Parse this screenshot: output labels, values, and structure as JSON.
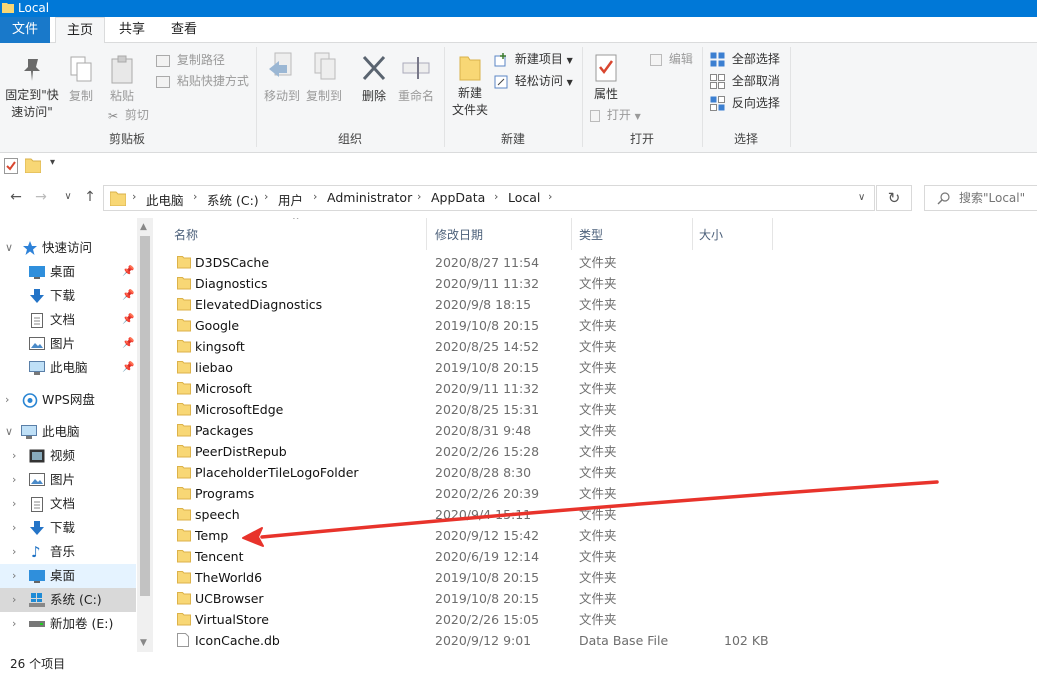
{
  "window": {
    "title": "Local"
  },
  "tabs": {
    "file": "文件",
    "home": "主页",
    "share": "共享",
    "view": "查看"
  },
  "ribbon": {
    "clipboard": {
      "title": "剪贴板",
      "pin": "固定到\"快\n速访问\"",
      "copy": "复制",
      "paste": "粘贴",
      "copy_path": "复制路径",
      "paste_shortcut": "粘贴快捷方式",
      "cut": "剪切"
    },
    "organize": {
      "title": "组织",
      "move_to": "移动到",
      "copy_to": "复制到",
      "delete": "删除",
      "rename": "重命名"
    },
    "new": {
      "title": "新建",
      "new_folder": "新建\n文件夹",
      "new_item": "新建项目",
      "easy_access": "轻松访问"
    },
    "open": {
      "title": "打开",
      "properties": "属性",
      "open": "打开",
      "edit": "编辑"
    },
    "select": {
      "title": "选择",
      "select_all": "全部选择",
      "select_none": "全部取消",
      "invert": "反向选择"
    }
  },
  "address": {
    "crumbs": [
      "此电脑",
      "系统 (C:)",
      "用户",
      "Administrator",
      "AppData",
      "Local"
    ],
    "search_placeholder": "搜索\"Local\""
  },
  "nav": {
    "quick_access": "快速访问",
    "quick_items": [
      "桌面",
      "下载",
      "文档",
      "图片",
      "此电脑"
    ],
    "wps": "WPS网盘",
    "this_pc": "此电脑",
    "pc_items": [
      "视频",
      "图片",
      "文档",
      "下载",
      "音乐",
      "桌面",
      "系统 (C:)",
      "新加卷 (E:)"
    ]
  },
  "columns": {
    "name": "名称",
    "date": "修改日期",
    "type": "类型",
    "size": "大小"
  },
  "files": [
    {
      "name": "D3DSCache",
      "date": "2020/8/27 11:54",
      "type": "文件夹",
      "size": ""
    },
    {
      "name": "Diagnostics",
      "date": "2020/9/11 11:32",
      "type": "文件夹",
      "size": ""
    },
    {
      "name": "ElevatedDiagnostics",
      "date": "2020/9/8 18:15",
      "type": "文件夹",
      "size": ""
    },
    {
      "name": "Google",
      "date": "2019/10/8 20:15",
      "type": "文件夹",
      "size": ""
    },
    {
      "name": "kingsoft",
      "date": "2020/8/25 14:52",
      "type": "文件夹",
      "size": ""
    },
    {
      "name": "liebao",
      "date": "2019/10/8 20:15",
      "type": "文件夹",
      "size": ""
    },
    {
      "name": "Microsoft",
      "date": "2020/9/11 11:32",
      "type": "文件夹",
      "size": ""
    },
    {
      "name": "MicrosoftEdge",
      "date": "2020/8/25 15:31",
      "type": "文件夹",
      "size": ""
    },
    {
      "name": "Packages",
      "date": "2020/8/31 9:48",
      "type": "文件夹",
      "size": ""
    },
    {
      "name": "PeerDistRepub",
      "date": "2020/2/26 15:28",
      "type": "文件夹",
      "size": ""
    },
    {
      "name": "PlaceholderTileLogoFolder",
      "date": "2020/8/28 8:30",
      "type": "文件夹",
      "size": ""
    },
    {
      "name": "Programs",
      "date": "2020/2/26 20:39",
      "type": "文件夹",
      "size": ""
    },
    {
      "name": "speech",
      "date": "2020/9/4 15:11",
      "type": "文件夹",
      "size": ""
    },
    {
      "name": "Temp",
      "date": "2020/9/12 15:42",
      "type": "文件夹",
      "size": ""
    },
    {
      "name": "Tencent",
      "date": "2020/6/19 12:14",
      "type": "文件夹",
      "size": ""
    },
    {
      "name": "TheWorld6",
      "date": "2019/10/8 20:15",
      "type": "文件夹",
      "size": ""
    },
    {
      "name": "UCBrowser",
      "date": "2019/10/8 20:15",
      "type": "文件夹",
      "size": ""
    },
    {
      "name": "VirtualStore",
      "date": "2020/2/26 15:05",
      "type": "文件夹",
      "size": ""
    },
    {
      "name": "IconCache.db",
      "date": "2020/9/12 9:01",
      "type": "Data Base File",
      "size": "102 KB"
    }
  ],
  "status": {
    "count": "26 个项目"
  },
  "colors": {
    "accent": "#0078d7",
    "folder": "#f8d775",
    "arrow": "#e8332b"
  }
}
